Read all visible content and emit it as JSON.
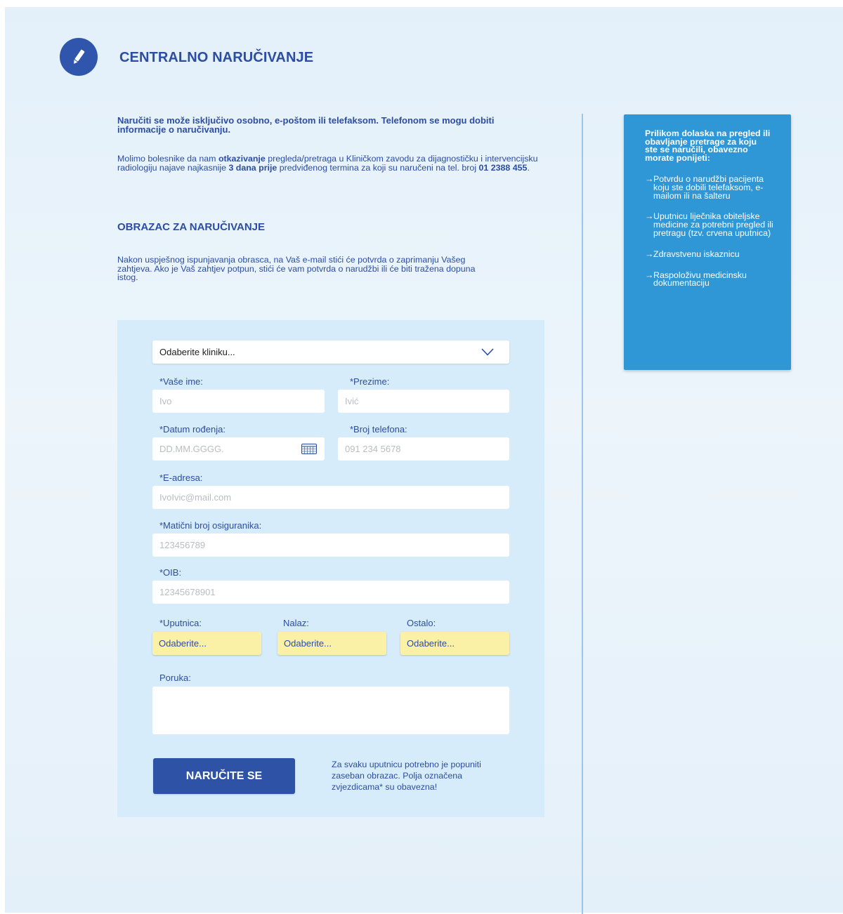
{
  "header": {
    "title": "CENTRALNO NARUČIVANJE",
    "logo_icon": "pencil-icon"
  },
  "intro": {
    "bold_text": "Naručiti se može isključivo osobno, e-poštom ili telefaksom. Telefonom se mogu dobiti informacije o naručivanju.",
    "p_part1": "Molimo bolesnike da nam ",
    "p_bold1": "otkazivanje",
    "p_part2": " pregleda/pretraga u Kliničkom zavodu za dijagnostičku i intervencijsku radiologiju najave najkasnije ",
    "p_bold2": "3 dana prije",
    "p_part3": " predviđenog termina za koji su naručeni na tel. broj ",
    "p_bold3": "01 2388 455",
    "p_part4": "."
  },
  "form_section": {
    "heading": "OBRAZAC ZA NARUČIVANJE",
    "description": "Nakon uspješnog ispunjavanja obrasca, na Vaš e-mail stići će potvrda o zaprimanju Vašeg zahtjeva. Ako je Vaš zahtjev potpun, stići će vam potvrda o narudžbi ili će biti tražena dopuna istog."
  },
  "form": {
    "clinic_select": {
      "value": "Odaberite kliniku...",
      "icon": "chevron-down-icon"
    },
    "first_name": {
      "label": "*Vaše ime:",
      "placeholder": "Ivo"
    },
    "last_name": {
      "label": "*Prezime:",
      "placeholder": "Ivić"
    },
    "birth_date": {
      "label": "*Datum rođenja:",
      "placeholder": "DD.MM.GGGG.",
      "icon": "calendar-icon"
    },
    "phone": {
      "label": "*Broj telefona:",
      "placeholder": "091 234 5678"
    },
    "email": {
      "label": "*E-adresa:",
      "placeholder": "IvoIvic@mail.com"
    },
    "insurance_number": {
      "label": "*Matični broj osiguranika:",
      "placeholder": "123456789"
    },
    "oib": {
      "label": "*OIB:",
      "placeholder": "12345678901"
    },
    "referral": {
      "label": "*Uputnica:",
      "button": "Odaberite..."
    },
    "findings": {
      "label": "Nalaz:",
      "button": "Odaberite..."
    },
    "other": {
      "label": "Ostalo:",
      "button": "Odaberite..."
    },
    "message": {
      "label": "Poruka:",
      "value": ""
    },
    "submit_label": "NARUČITE SE",
    "note": "Za svaku uputnicu potrebno je popuniti zaseban obrazac. Polja označena zvjezdicama* su obavezna!"
  },
  "sidebar": {
    "title": "Prilikom dolaska na pregled ili obavljanje pretrage za koju ste se naručili, obavezno morate ponijeti:",
    "arrow": "→",
    "items": [
      "Potvrdu o narudžbi pacijenta koju ste dobili telefaksom, e-mailom ili na šalteru",
      "Uputnicu liječnika obiteljske medicine za potrebni pregled ili pretragu (tzv. crvena uputnica)",
      "Zdravstvenu iskaznicu",
      "Raspoloživu medicinsku dokumentaciju"
    ]
  },
  "colors": {
    "primary": "#2b4da3",
    "button": "#2e52a6",
    "sidebar": "#2f97d6",
    "form_panel": "#d6ecfb",
    "yellow_select": "#fbf1a6"
  }
}
